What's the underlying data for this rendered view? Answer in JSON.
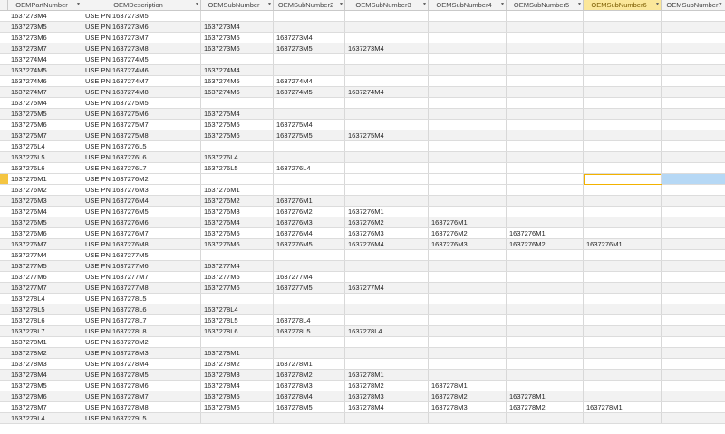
{
  "columns": [
    {
      "label": "OEMPartNumber"
    },
    {
      "label": "OEMDescription"
    },
    {
      "label": "OEMSubNumber"
    },
    {
      "label": "OEMSubNumber2"
    },
    {
      "label": "OEMSubNumber3"
    },
    {
      "label": "OEMSubNumber4"
    },
    {
      "label": "OEMSubNumber5"
    },
    {
      "label": "OEMSubNumber6"
    },
    {
      "label": "OEMSubNumber7"
    }
  ],
  "active_column": 7,
  "colors": {
    "active_header": "#fbe79a",
    "selection": "#b6d8f5",
    "focus_border": "#f2b200"
  },
  "rows": [
    [
      "1637273M4",
      "USE PN 1637273M5",
      "",
      "",
      "",
      "",
      "",
      "",
      ""
    ],
    [
      "1637273M5",
      "USE PN 1637273M6",
      "1637273M4",
      "",
      "",
      "",
      "",
      "",
      ""
    ],
    [
      "1637273M6",
      "USE PN 1637273M7",
      "1637273M5",
      "1637273M4",
      "",
      "",
      "",
      "",
      ""
    ],
    [
      "1637273M7",
      "USE PN 1637273M8",
      "1637273M6",
      "1637273M5",
      "1637273M4",
      "",
      "",
      "",
      ""
    ],
    [
      "1637274M4",
      "USE PN 1637274M5",
      "",
      "",
      "",
      "",
      "",
      "",
      ""
    ],
    [
      "1637274M5",
      "USE PN 1637274M6",
      "1637274M4",
      "",
      "",
      "",
      "",
      "",
      ""
    ],
    [
      "1637274M6",
      "USE PN 1637274M7",
      "1637274M5",
      "1637274M4",
      "",
      "",
      "",
      "",
      ""
    ],
    [
      "1637274M7",
      "USE PN 1637274M8",
      "1637274M6",
      "1637274M5",
      "1637274M4",
      "",
      "",
      "",
      ""
    ],
    [
      "1637275M4",
      "USE PN 1637275M5",
      "",
      "",
      "",
      "",
      "",
      "",
      ""
    ],
    [
      "1637275M5",
      "USE PN 1637275M6",
      "1637275M4",
      "",
      "",
      "",
      "",
      "",
      ""
    ],
    [
      "1637275M6",
      "USE PN 1637275M7",
      "1637275M5",
      "1637275M4",
      "",
      "",
      "",
      "",
      ""
    ],
    [
      "1637275M7",
      "USE PN 1637275M8",
      "1637275M6",
      "1637275M5",
      "1637275M4",
      "",
      "",
      "",
      ""
    ],
    [
      "1637276L4",
      "USE PN 1637276L5",
      "",
      "",
      "",
      "",
      "",
      "",
      ""
    ],
    [
      "1637276L5",
      "USE PN 1637276L6",
      "1637276L4",
      "",
      "",
      "",
      "",
      "",
      ""
    ],
    [
      "1637276L6",
      "USE PN 1637276L7",
      "1637276L5",
      "1637276L4",
      "",
      "",
      "",
      "",
      ""
    ],
    [
      "1637276M1",
      "USE PN 1637276M2",
      "",
      "",
      "",
      "",
      "",
      "",
      ""
    ],
    [
      "1637276M2",
      "USE PN 1637276M3",
      "1637276M1",
      "",
      "",
      "",
      "",
      "",
      ""
    ],
    [
      "1637276M3",
      "USE PN 1637276M4",
      "1637276M2",
      "1637276M1",
      "",
      "",
      "",
      "",
      ""
    ],
    [
      "1637276M4",
      "USE PN 1637276M5",
      "1637276M3",
      "1637276M2",
      "1637276M1",
      "",
      "",
      "",
      ""
    ],
    [
      "1637276M5",
      "USE PN 1637276M6",
      "1637276M4",
      "1637276M3",
      "1637276M2",
      "1637276M1",
      "",
      "",
      ""
    ],
    [
      "1637276M6",
      "USE PN 1637276M7",
      "1637276M5",
      "1637276M4",
      "1637276M3",
      "1637276M2",
      "1637276M1",
      "",
      ""
    ],
    [
      "1637276M7",
      "USE PN 1637276M8",
      "1637276M6",
      "1637276M5",
      "1637276M4",
      "1637276M3",
      "1637276M2",
      "1637276M1",
      ""
    ],
    [
      "1637277M4",
      "USE PN 1637277M5",
      "",
      "",
      "",
      "",
      "",
      "",
      ""
    ],
    [
      "1637277M5",
      "USE PN 1637277M6",
      "1637277M4",
      "",
      "",
      "",
      "",
      "",
      ""
    ],
    [
      "1637277M6",
      "USE PN 1637277M7",
      "1637277M5",
      "1637277M4",
      "",
      "",
      "",
      "",
      ""
    ],
    [
      "1637277M7",
      "USE PN 1637277M8",
      "1637277M6",
      "1637277M5",
      "1637277M4",
      "",
      "",
      "",
      ""
    ],
    [
      "1637278L4",
      "USE PN 1637278L5",
      "",
      "",
      "",
      "",
      "",
      "",
      ""
    ],
    [
      "1637278L5",
      "USE PN 1637278L6",
      "1637278L4",
      "",
      "",
      "",
      "",
      "",
      ""
    ],
    [
      "1637278L6",
      "USE PN 1637278L7",
      "1637278L5",
      "1637278L4",
      "",
      "",
      "",
      "",
      ""
    ],
    [
      "1637278L7",
      "USE PN 1637278L8",
      "1637278L6",
      "1637278L5",
      "1637278L4",
      "",
      "",
      "",
      ""
    ],
    [
      "1637278M1",
      "USE PN 1637278M2",
      "",
      "",
      "",
      "",
      "",
      "",
      ""
    ],
    [
      "1637278M2",
      "USE PN 1637278M3",
      "1637278M1",
      "",
      "",
      "",
      "",
      "",
      ""
    ],
    [
      "1637278M3",
      "USE PN 1637278M4",
      "1637278M2",
      "1637278M1",
      "",
      "",
      "",
      "",
      ""
    ],
    [
      "1637278M4",
      "USE PN 1637278M5",
      "1637278M3",
      "1637278M2",
      "1637278M1",
      "",
      "",
      "",
      ""
    ],
    [
      "1637278M5",
      "USE PN 1637278M6",
      "1637278M4",
      "1637278M3",
      "1637278M2",
      "1637278M1",
      "",
      "",
      ""
    ],
    [
      "1637278M6",
      "USE PN 1637278M7",
      "1637278M5",
      "1637278M4",
      "1637278M3",
      "1637278M2",
      "1637278M1",
      "",
      ""
    ],
    [
      "1637278M7",
      "USE PN 1637278M8",
      "1637278M6",
      "1637278M5",
      "1637278M4",
      "1637278M3",
      "1637278M2",
      "1637278M1",
      ""
    ],
    [
      "1637279L4",
      "USE PN 1637279L5",
      "",
      "",
      "",
      "",
      "",
      "",
      ""
    ]
  ],
  "current_row": 15
}
